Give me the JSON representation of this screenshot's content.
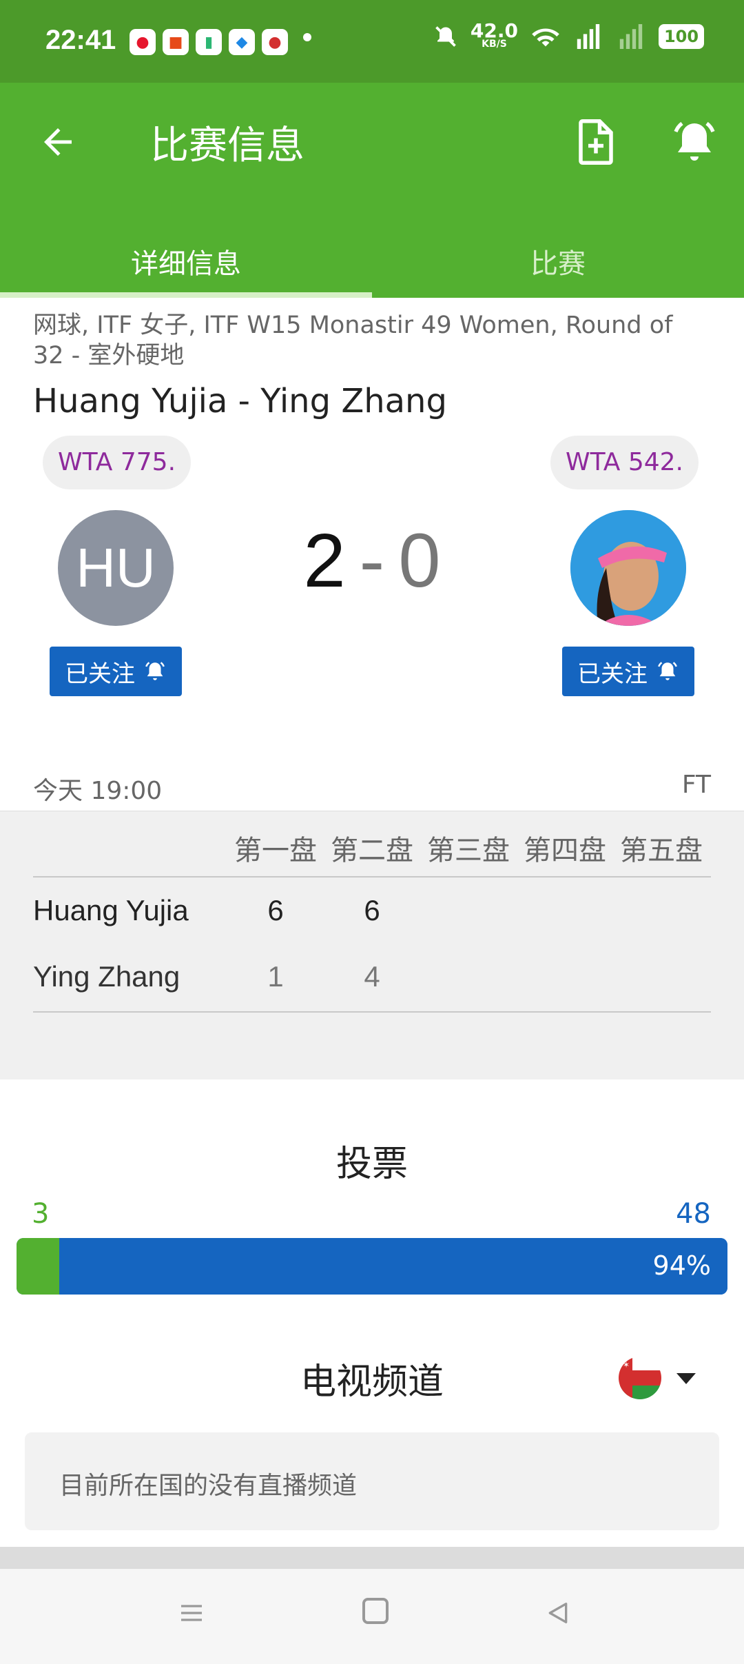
{
  "status_bar": {
    "time": "22:41",
    "network_speed": "42.0",
    "network_unit": "KB/S",
    "battery": "100"
  },
  "app_bar": {
    "title": "比赛信息",
    "tabs": [
      {
        "label": "详细信息",
        "active": true
      },
      {
        "label": "比赛",
        "active": false
      }
    ]
  },
  "match": {
    "meta": "网球, ITF 女子, ITF W15 Monastir 49 Women, Round of 32 - 室外硬地",
    "title": "Huang Yujia - Ying Zhang",
    "home": {
      "rank": "WTA 775.",
      "initials": "HU",
      "follow_label": "已关注"
    },
    "away": {
      "rank": "WTA 542.",
      "follow_label": "已关注"
    },
    "score_home": "2",
    "score_sep": "-",
    "score_away": "0",
    "date": "今天 19:00",
    "status": "FT"
  },
  "sets": {
    "headers": [
      "第一盘",
      "第二盘",
      "第三盘",
      "第四盘",
      "第五盘"
    ],
    "rows": [
      {
        "name": "Huang Yujia",
        "scores": [
          "6",
          "6",
          "",
          "",
          ""
        ],
        "winner": true
      },
      {
        "name": "Ying Zhang",
        "scores": [
          "1",
          "4",
          "",
          "",
          ""
        ],
        "winner": false
      }
    ]
  },
  "votes": {
    "title": "投票",
    "home_count": "3",
    "away_count": "48",
    "away_percent_label": "94%",
    "home_fraction": 0.06
  },
  "tv": {
    "title": "电视频道",
    "message": "目前所在国的没有直播频道"
  },
  "colors": {
    "header_green": "#53b030",
    "status_green": "#4c9a2a",
    "follow_blue": "#1565c0",
    "rank_purple": "#8e2a9c"
  }
}
